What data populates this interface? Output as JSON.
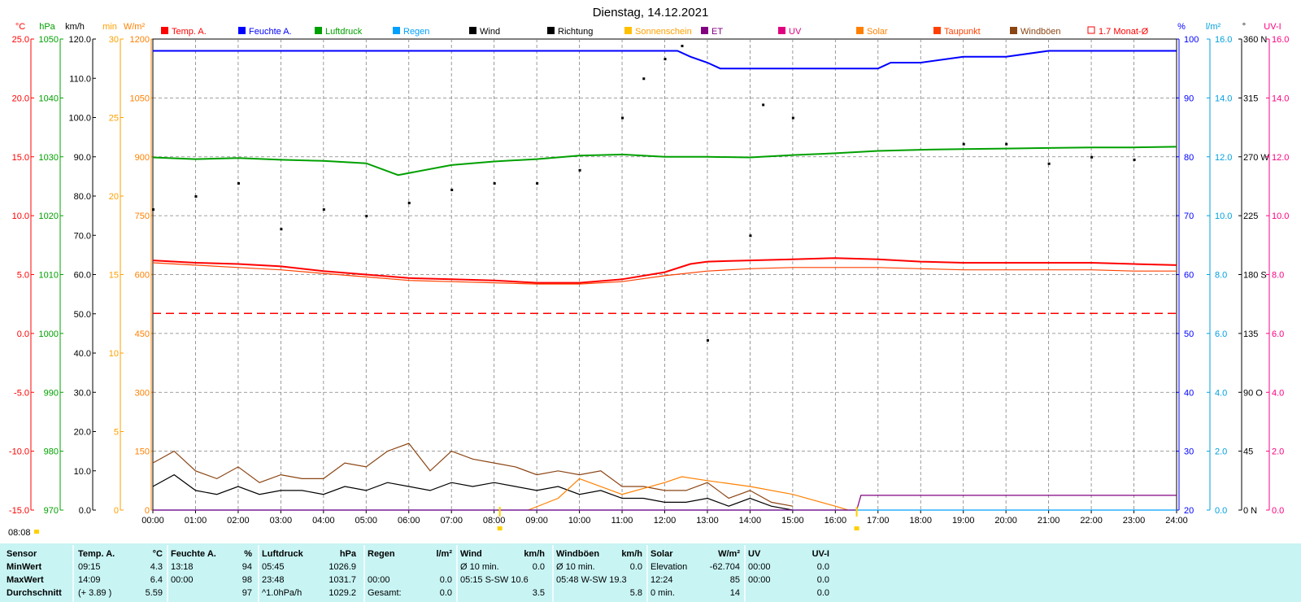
{
  "title": "Dienstag, 14.12.2021",
  "sunrise_label": "08:08",
  "legend": [
    {
      "label": "Temp. A.",
      "color": "#ff0000",
      "style": "fill"
    },
    {
      "label": "Feuchte A.",
      "color": "#0000ff",
      "style": "fill"
    },
    {
      "label": "Luftdruck",
      "color": "#00a000",
      "style": "fill"
    },
    {
      "label": "Regen",
      "color": "#00a0ff",
      "style": "fill"
    },
    {
      "label": "Wind",
      "color": "#000000",
      "style": "fill"
    },
    {
      "label": "Richtung",
      "color": "#000000",
      "style": "fill"
    },
    {
      "label": "Sonnenschein",
      "color": "#ffc000",
      "style": "fill"
    },
    {
      "label": "ET",
      "color": "#800080",
      "style": "fill"
    },
    {
      "label": "UV",
      "color": "#e0007f",
      "style": "fill"
    },
    {
      "label": "Solar",
      "color": "#ff8000",
      "style": "fill"
    },
    {
      "label": "Taupunkt",
      "color": "#ff4000",
      "style": "fill"
    },
    {
      "label": "Windböen",
      "color": "#8b4513",
      "style": "fill"
    },
    {
      "label": "1.7 Monat-Ø",
      "color": "#ff0000",
      "style": "outline"
    }
  ],
  "axes": {
    "temp": {
      "unit": "°C",
      "color": "#ff0000",
      "ticks": [
        "25.0",
        "20.0",
        "15.0",
        "10.0",
        "5.0",
        "0.0",
        "-5.0",
        "-10.0",
        "-15.0"
      ]
    },
    "hpa": {
      "unit": "hPa",
      "color": "#00a000",
      "ticks": [
        "1050",
        "1040",
        "1030",
        "1020",
        "1010",
        "1000",
        "990",
        "980",
        "970"
      ]
    },
    "kmh": {
      "unit": "km/h",
      "color": "#000000",
      "ticks": [
        "120.0",
        "110.0",
        "100.0",
        "90.0",
        "80.0",
        "70.0",
        "60.0",
        "50.0",
        "40.0",
        "30.0",
        "20.0",
        "10.0",
        "0.0"
      ]
    },
    "min": {
      "unit": "min",
      "color": "#ffa000",
      "ticks": [
        "30",
        "25",
        "20",
        "15",
        "10",
        "5",
        "0"
      ]
    },
    "wm2": {
      "unit": "W/m²",
      "color": "#ff8000",
      "ticks": [
        "1200",
        "1050",
        "900",
        "750",
        "600",
        "450",
        "300",
        "150",
        "0"
      ]
    },
    "pct": {
      "unit": "%",
      "color": "#0000ff",
      "ticks": [
        "100",
        "90",
        "80",
        "70",
        "60",
        "50",
        "40",
        "30",
        "20"
      ]
    },
    "lm2": {
      "unit": "l/m²",
      "color": "#00a0e0",
      "ticks": [
        "16.0",
        "14.0",
        "12.0",
        "10.0",
        "8.0",
        "6.0",
        "4.0",
        "2.0",
        "0.0"
      ]
    },
    "deg": {
      "unit": "°",
      "color": "#000000",
      "ticks": [
        "360 N",
        "315",
        "270 W",
        "225",
        "180 S",
        "135",
        "90 O",
        "45",
        "0 N"
      ]
    },
    "uvi": {
      "unit": "UV-I",
      "color": "#ff0080",
      "ticks": [
        "16.0",
        "14.0",
        "12.0",
        "10.0",
        "8.0",
        "6.0",
        "4.0",
        "2.0",
        "0.0"
      ]
    },
    "time": [
      "00:00",
      "01:00",
      "02:00",
      "03:00",
      "04:00",
      "05:00",
      "06:00",
      "07:00",
      "08:00",
      "09:00",
      "10:00",
      "11:00",
      "12:00",
      "13:00",
      "14:00",
      "15:00",
      "16:00",
      "17:00",
      "18:00",
      "19:00",
      "20:00",
      "21:00",
      "22:00",
      "23:00",
      "24:00"
    ]
  },
  "chart_data": {
    "type": "line",
    "title": "Dienstag, 14.12.2021",
    "x_unit": "hours",
    "xlim": [
      0,
      24
    ],
    "series": [
      {
        "name": "Temp. A.",
        "axis": "°C",
        "color": "#ff0000",
        "x": [
          0,
          1,
          2,
          3,
          4,
          5,
          6,
          7,
          8,
          9,
          10,
          11,
          12,
          12.6,
          13,
          14,
          15,
          16,
          17,
          18,
          19,
          20,
          21,
          22,
          23,
          24
        ],
        "values": [
          6.2,
          6.0,
          5.9,
          5.7,
          5.3,
          5.0,
          4.7,
          4.6,
          4.5,
          4.3,
          4.3,
          4.6,
          5.2,
          5.9,
          6.1,
          6.2,
          6.3,
          6.4,
          6.3,
          6.1,
          6.0,
          6.0,
          6.0,
          6.0,
          5.9,
          5.8
        ]
      },
      {
        "name": "Taupunkt",
        "axis": "°C",
        "color": "#ff4000",
        "x": [
          0,
          1,
          2,
          3,
          4,
          5,
          6,
          7,
          8,
          9,
          10,
          11,
          12,
          13,
          14,
          15,
          16,
          17,
          18,
          19,
          20,
          21,
          22,
          23,
          24
        ],
        "values": [
          6.0,
          5.8,
          5.6,
          5.4,
          5.1,
          4.8,
          4.5,
          4.4,
          4.3,
          4.2,
          4.2,
          4.4,
          4.9,
          5.3,
          5.5,
          5.6,
          5.6,
          5.6,
          5.5,
          5.4,
          5.4,
          5.4,
          5.4,
          5.3,
          5.3
        ]
      },
      {
        "name": "Feuchte A.",
        "axis": "%",
        "color": "#0000ff",
        "x": [
          0,
          12.3,
          12.6,
          13,
          13.3,
          17,
          17.3,
          18,
          19,
          20,
          21,
          22,
          23,
          24
        ],
        "values": [
          98,
          98,
          97,
          96,
          95,
          95,
          96,
          96,
          97,
          97,
          98,
          98,
          98,
          98
        ]
      },
      {
        "name": "Luftdruck",
        "axis": "hPa",
        "color": "#00a000",
        "x": [
          0,
          1,
          2,
          3,
          4,
          5,
          5.75,
          7,
          8,
          9,
          10,
          11,
          12,
          13,
          14,
          15,
          16,
          17,
          18,
          19,
          20,
          21,
          22,
          23,
          24
        ],
        "values": [
          1029.9,
          1029.6,
          1029.8,
          1029.5,
          1029.3,
          1028.9,
          1026.9,
          1028.6,
          1029.2,
          1029.6,
          1030.2,
          1030.4,
          1030.0,
          1030.0,
          1029.9,
          1030.3,
          1030.6,
          1031.0,
          1031.2,
          1031.3,
          1031.4,
          1031.5,
          1031.6,
          1031.6,
          1031.7
        ]
      },
      {
        "name": "1.7 Monat-Ø",
        "axis": "°C",
        "color": "#ff0000",
        "style": "dashed",
        "x": [
          0,
          24
        ],
        "values": [
          1.7,
          1.7
        ]
      },
      {
        "name": "Wind",
        "axis": "km/h",
        "color": "#000000",
        "x": [
          0,
          0.5,
          1,
          1.5,
          2,
          2.5,
          3,
          3.5,
          4,
          4.5,
          5,
          5.5,
          6,
          6.5,
          7,
          7.5,
          8,
          8.5,
          9,
          9.5,
          10,
          10.5,
          11,
          11.5,
          12,
          12.5,
          13,
          13.5,
          14,
          14.5,
          15
        ],
        "values": [
          6,
          9,
          5,
          4,
          6,
          4,
          5,
          5,
          4,
          6,
          5,
          7,
          6,
          5,
          7,
          6,
          7,
          6,
          5,
          6,
          4,
          5,
          3,
          3,
          2,
          2,
          3,
          1,
          3,
          1,
          0
        ]
      },
      {
        "name": "Windböen",
        "axis": "km/h",
        "color": "#8b4513",
        "x": [
          0,
          0.5,
          1,
          1.5,
          2,
          2.5,
          3,
          3.5,
          4,
          4.5,
          5,
          5.5,
          6,
          6.5,
          7,
          7.5,
          8,
          8.5,
          9,
          9.5,
          10,
          10.5,
          11,
          11.5,
          12,
          12.5,
          13,
          13.5,
          14,
          14.5,
          15
        ],
        "values": [
          12,
          15,
          10,
          8,
          11,
          7,
          9,
          8,
          8,
          12,
          11,
          15,
          17,
          10,
          15,
          13,
          12,
          11,
          9,
          10,
          9,
          10,
          6,
          6,
          5,
          5,
          7,
          3,
          5,
          2,
          1
        ]
      },
      {
        "name": "Solar",
        "axis": "W/m²",
        "color": "#ff8000",
        "x": [
          8.8,
          9.5,
          10,
          11,
          12,
          12.4,
          13,
          14,
          15,
          16,
          16.3
        ],
        "values": [
          0,
          30,
          80,
          40,
          70,
          85,
          75,
          60,
          40,
          10,
          0
        ]
      },
      {
        "name": "Richtung",
        "axis": "°",
        "color": "#000000",
        "style": "dots",
        "x": [
          0,
          1,
          2,
          3,
          4,
          5,
          6,
          7,
          8,
          9,
          10,
          11,
          11.5,
          12,
          12.4,
          13,
          14,
          14.3,
          15,
          19,
          20,
          21,
          22,
          23
        ],
        "values": [
          230,
          240,
          250,
          215,
          230,
          225,
          235,
          245,
          250,
          250,
          260,
          300,
          330,
          345,
          355,
          130,
          210,
          310,
          300,
          280,
          280,
          265,
          270,
          268
        ]
      },
      {
        "name": "Regen",
        "axis": "l/m²",
        "color": "#00a0ff",
        "x": [
          0,
          24
        ],
        "values": [
          0,
          0
        ]
      },
      {
        "name": "ET",
        "axis": "l/m²",
        "color": "#800080",
        "x": [
          0,
          16.5,
          16.6,
          24
        ],
        "values": [
          0,
          0,
          0.5,
          0.5
        ]
      }
    ],
    "markers": {
      "sunrise": "08:08",
      "sunset_hour": 16.5
    },
    "grid": true
  },
  "table": {
    "header": [
      "Sensor",
      "Temp. A.",
      "°C",
      "Feuchte A.",
      "%",
      "Luftdruck",
      "hPa",
      "Regen",
      "l/m²",
      "Wind",
      "km/h",
      "Windböen",
      "km/h",
      "Solar",
      "W/m²",
      "UV",
      "UV-I"
    ],
    "rows": [
      [
        "MinWert",
        "09:15",
        "4.3",
        "13:18",
        "94",
        "05:45",
        "1026.9",
        "",
        "",
        "Ø 10 min.",
        "0.0",
        "Ø 10 min.",
        "0.0",
        "Elevation",
        "-62.704",
        "00:00",
        "0.0"
      ],
      [
        "MaxWert",
        "14:09",
        "6.4",
        "00:00",
        "98",
        "23:48",
        "1031.7",
        "00:00",
        "0.0",
        "05:15   S-SW 10.6",
        "",
        "05:48   W-SW 19.3",
        "",
        "12:24",
        "85",
        "00:00",
        "0.0"
      ],
      [
        "Durchschnitt",
        "(+ 3.89 )",
        "5.59",
        "",
        "97",
        "^1.0hPa/h",
        "1029.2",
        "Gesamt:",
        "0.0",
        "",
        "3.5",
        "",
        "5.8",
        "0 min.",
        "14",
        "",
        "0.0"
      ]
    ]
  }
}
